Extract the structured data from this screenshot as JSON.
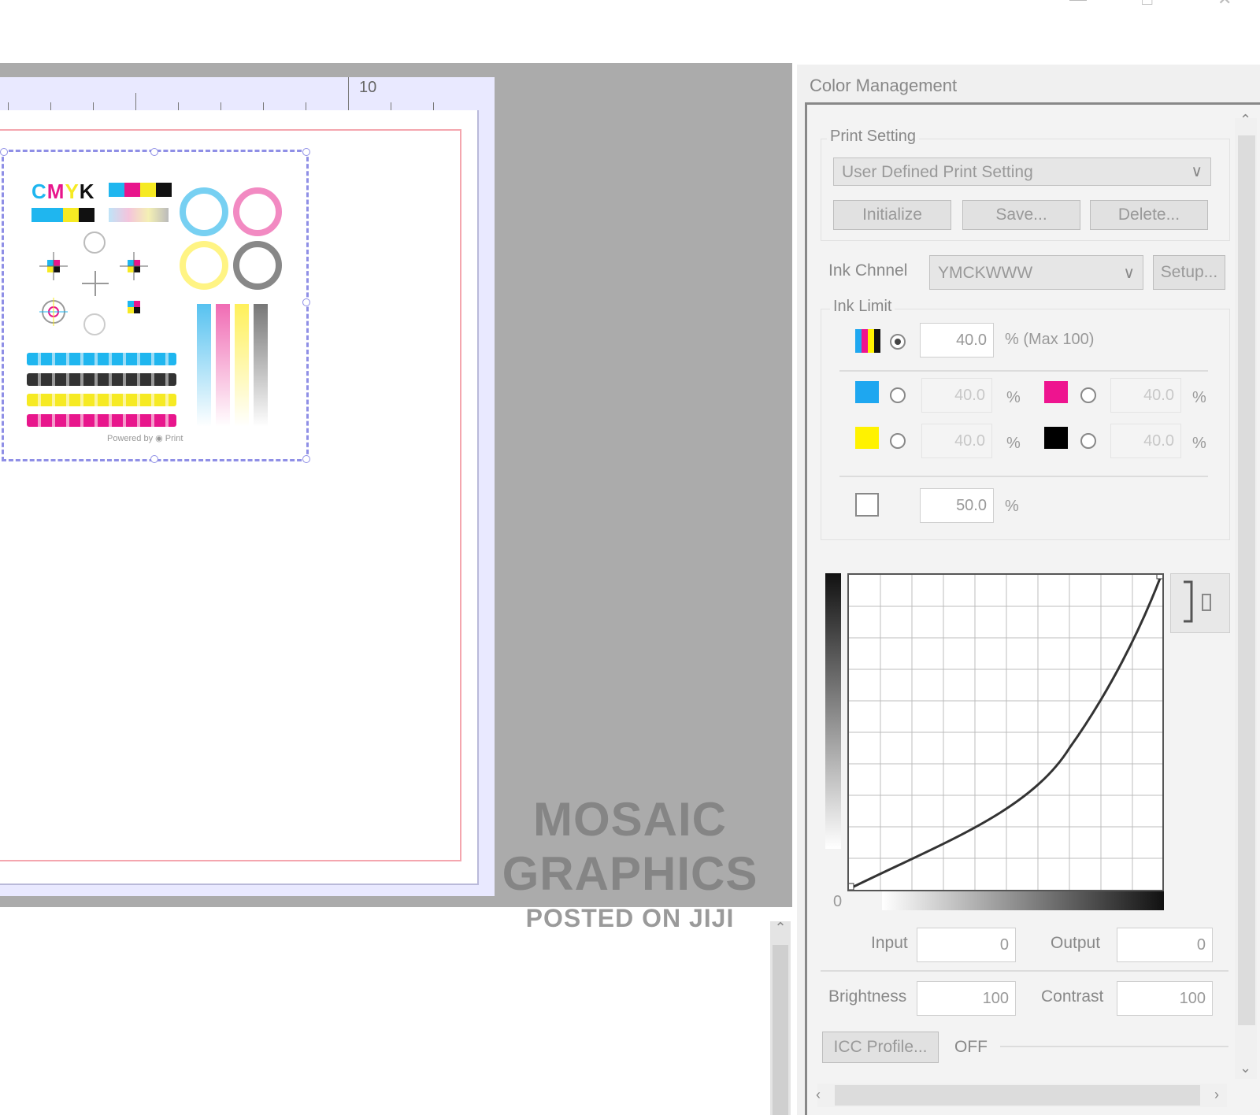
{
  "window": {
    "controls": [
      "—",
      "□",
      "✕"
    ]
  },
  "ruler": {
    "label": "10"
  },
  "artwork": {
    "title_letters": [
      {
        "ch": "C",
        "color": "#1fb6ef"
      },
      {
        "ch": "M",
        "color": "#e8168c"
      },
      {
        "ch": "Y",
        "color": "#f6ea23"
      },
      {
        "ch": "K",
        "color": "#111111"
      }
    ],
    "footer_text": "Powered by ◉ Print"
  },
  "panel": {
    "title": "Color Management",
    "print_setting": {
      "group_label": "Print Setting",
      "selected": "User Defined Print Setting",
      "buttons": {
        "initialize": "Initialize",
        "save": "Save...",
        "delete": "Delete..."
      }
    },
    "ink_channel": {
      "label": "Ink Chnnel",
      "selected": "YMCKWWW",
      "setup_button": "Setup..."
    },
    "ink_limit": {
      "group_label": "Ink Limit",
      "total": {
        "value": "40.0",
        "suffix": "% (Max 100)"
      },
      "cyan": {
        "value": "40.0",
        "suffix": "%"
      },
      "magenta": {
        "value": "40.0",
        "suffix": "%"
      },
      "yellow": {
        "value": "40.0",
        "suffix": "%"
      },
      "black": {
        "value": "40.0",
        "suffix": "%"
      },
      "white": {
        "value": "50.0",
        "suffix": "%"
      }
    },
    "curve": {
      "origin_label": "0"
    },
    "input": {
      "label": "Input",
      "value": "0"
    },
    "output": {
      "label": "Output",
      "value": "0"
    },
    "brightness": {
      "label": "Brightness",
      "value": "100"
    },
    "contrast": {
      "label": "Contrast",
      "value": "100"
    },
    "icc": {
      "button": "ICC Profile...",
      "status": "OFF"
    }
  },
  "colors": {
    "cyan": "#1ea7f0",
    "magenta": "#ee148f",
    "yellow": "#fff200",
    "black": "#000000"
  },
  "watermark": {
    "line1": "MOSAIC GRAPHICS",
    "line2": "POSTED ON JIJI"
  }
}
